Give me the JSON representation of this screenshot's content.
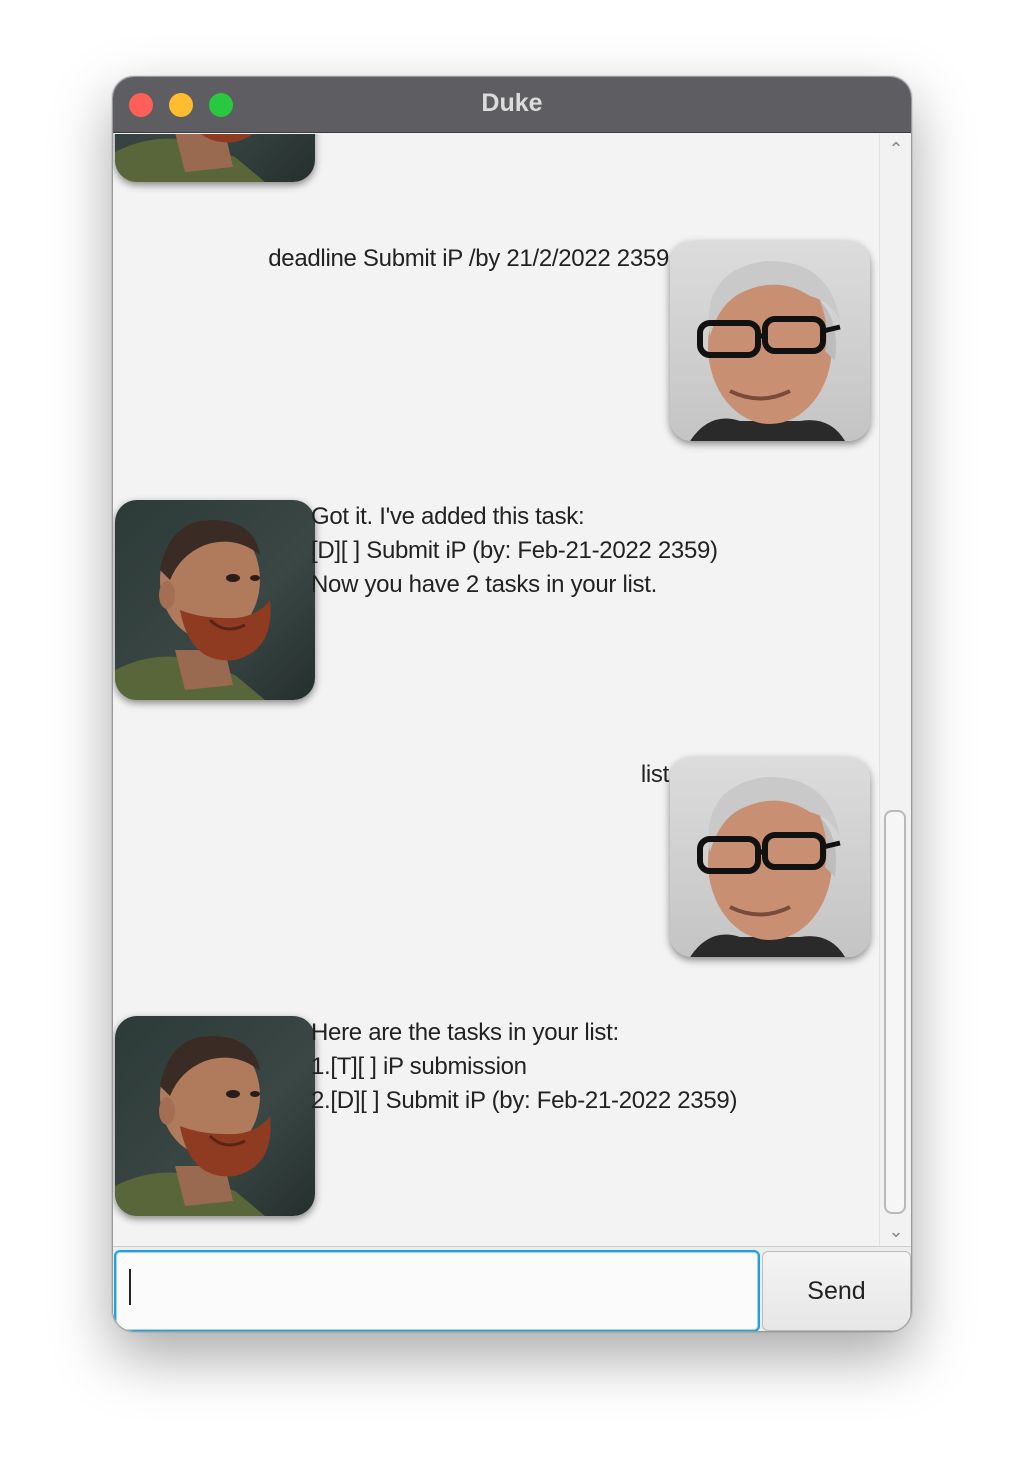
{
  "window": {
    "title": "Duke"
  },
  "messages": [
    {
      "sender": "user",
      "lines": [
        "deadline Submit iP /by 21/2/2022 2359"
      ]
    },
    {
      "sender": "duke",
      "lines": [
        "Got it. I've added this task:",
        "[D][ ] Submit iP (by: Feb-21-2022 2359)",
        "Now you have 2 tasks in your list."
      ]
    },
    {
      "sender": "user",
      "lines": [
        "list"
      ]
    },
    {
      "sender": "duke",
      "lines": [
        "Here are the tasks in your list:",
        "1.[T][ ] iP submission",
        "2.[D][ ] Submit iP (by: Feb-21-2022 2359)"
      ]
    }
  ],
  "input": {
    "value": "",
    "placeholder": ""
  },
  "send_label": "Send",
  "colors": {
    "titlebar": "#5e5d62",
    "focus_ring": "#1ea0e2",
    "close": "#fe5f57",
    "minimize": "#febc2e",
    "maximize": "#28c840"
  }
}
